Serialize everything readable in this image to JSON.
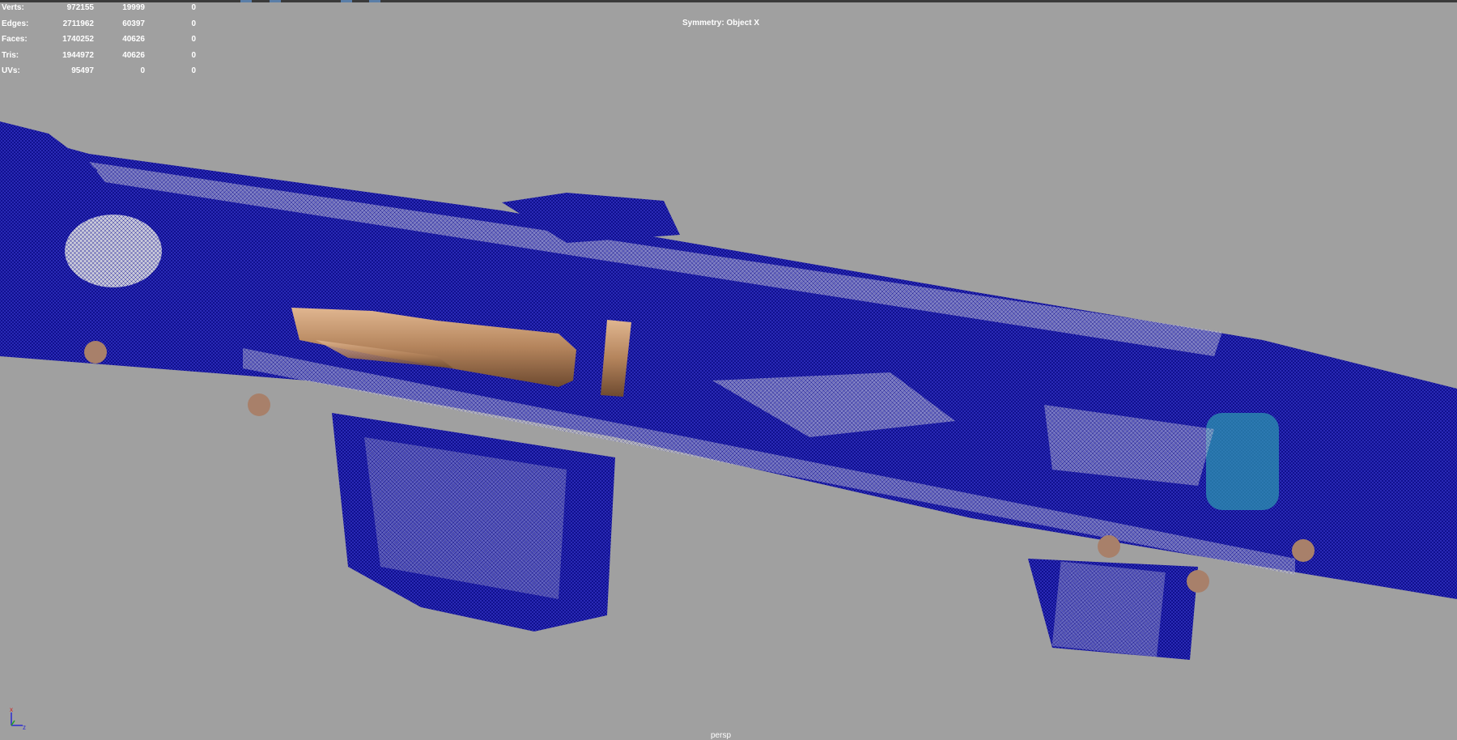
{
  "hud": {
    "rows": [
      {
        "label": "Verts:",
        "v1": "972155",
        "v2": "19999",
        "v3": "0"
      },
      {
        "label": "Edges:",
        "v1": "2711962",
        "v2": "60397",
        "v3": "0"
      },
      {
        "label": "Faces:",
        "v1": "1740252",
        "v2": "40626",
        "v3": "0"
      },
      {
        "label": "Tris:",
        "v1": "1944972",
        "v2": "40626",
        "v3": "0"
      },
      {
        "label": "UVs:",
        "v1": "95497",
        "v2": "0",
        "v3": "0"
      }
    ]
  },
  "viewport": {
    "symmetry": "Symmetry: Object X",
    "camera": "persp",
    "background": "#a0a0a0",
    "wire_color": "#0a0a8c",
    "brass_color": "#b88a5e"
  },
  "axis": {
    "x_label": "x",
    "z_label": "z"
  }
}
